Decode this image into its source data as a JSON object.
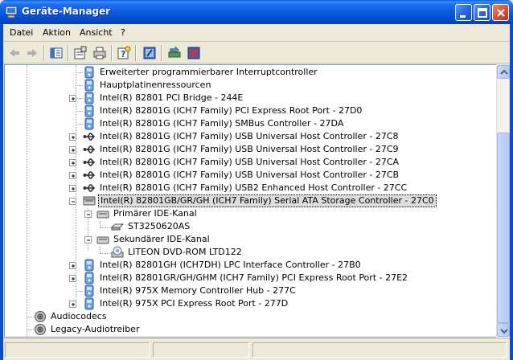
{
  "window": {
    "title": "Geräte-Manager",
    "icon": "computer-icon"
  },
  "menu": [
    {
      "label": "Datei"
    },
    {
      "label": "Aktion"
    },
    {
      "label": "Ansicht"
    },
    {
      "label": "?"
    }
  ],
  "toolbar": {
    "buttons": [
      "back-arrow-icon",
      "forward-arrow-icon",
      "tree-view-icon",
      "properties-icon",
      "print-icon",
      "help-icon",
      "scan-hardware-icon",
      "update-driver-icon",
      "uninstall-icon"
    ]
  },
  "tree": {
    "rows": [
      {
        "label": "Erweiterter programmierbarer Interruptcontroller",
        "icon": "system-device-icon"
      },
      {
        "label": "Hauptplatinenressourcen",
        "icon": "system-device-icon"
      },
      {
        "label": "Intel(R) 82801 PCI Bridge - 244E",
        "icon": "system-device-icon"
      },
      {
        "label": "Intel(R) 82801G (ICH7 Family) PCI Express Root Port - 27D0",
        "icon": "system-device-icon"
      },
      {
        "label": "Intel(R) 82801G (ICH7 Family) SMBus Controller - 27DA",
        "icon": "system-device-icon"
      },
      {
        "label": "Intel(R) 82801G (ICH7 Family) USB Universal Host Controller - 27C8",
        "icon": "usb-icon"
      },
      {
        "label": "Intel(R) 82801G (ICH7 Family) USB Universal Host Controller - 27C9",
        "icon": "usb-icon"
      },
      {
        "label": "Intel(R) 82801G (ICH7 Family) USB Universal Host Controller - 27CA",
        "icon": "usb-icon"
      },
      {
        "label": "Intel(R) 82801G (ICH7 Family) USB Universal Host Controller - 27CB",
        "icon": "usb-icon"
      },
      {
        "label": "Intel(R) 82801G (ICH7 Family) USB2 Enhanced Host Controller - 27CC",
        "icon": "usb-icon"
      },
      {
        "label": "Intel(R) 82801GB/GR/GH (ICH7 Family) Serial ATA Storage Controller - 27C0",
        "icon": "ide-controller-icon"
      },
      {
        "label": "Primärer IDE-Kanal",
        "icon": "ide-channel-icon"
      },
      {
        "label": "ST3250620AS",
        "icon": "hard-disk-icon"
      },
      {
        "label": "Sekundärer IDE-Kanal",
        "icon": "ide-channel-icon"
      },
      {
        "label": "LITEON DVD-ROM LTD122",
        "icon": "dvd-drive-icon"
      },
      {
        "label": "Intel(R) 82801GH (ICH7DH) LPC Interface Controller - 27B0",
        "icon": "system-device-icon"
      },
      {
        "label": "Intel(R) 82801GR/GH/GHM (ICH7 Family) PCI Express Root Port - 27E2",
        "icon": "system-device-icon"
      },
      {
        "label": "Intel(R) 975X Memory Controller Hub - 277C",
        "icon": "system-device-icon"
      },
      {
        "label": "Intel(R) 975X PCI Express Root Port - 277D",
        "icon": "system-device-icon"
      },
      {
        "label": "Audiocodecs",
        "icon": "audio-codec-icon"
      },
      {
        "label": "Legacy-Audiotreiber",
        "icon": "audio-codec-icon"
      }
    ],
    "selected_label": "Intel(R) 82801GB/GR/GH (ICH7 Family) Serial ATA Storage Controller - 27C0"
  },
  "colors": {
    "titlebar": "#0855DD",
    "selection": "#DCDCDC"
  }
}
